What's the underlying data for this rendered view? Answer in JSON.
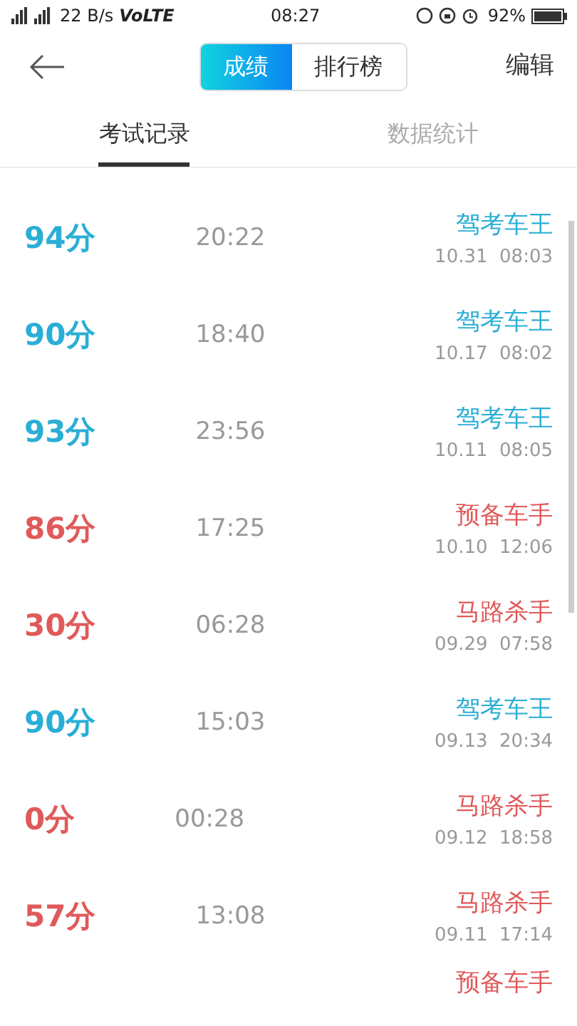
{
  "status_bar": {
    "network_speed": "22 B/s",
    "volte": "VoLTE",
    "time": "08:27",
    "battery": "92%"
  },
  "header": {
    "segments": [
      {
        "label": "成绩",
        "selected": true
      },
      {
        "label": "排行榜",
        "selected": false
      }
    ],
    "action": "编辑"
  },
  "tabs": [
    {
      "label": "考试记录",
      "selected": true
    },
    {
      "label": "数据统计",
      "selected": false
    }
  ],
  "records": [
    {
      "score": "94分",
      "duration": "20:22",
      "title": "驾考车王",
      "date": "10.31  08:03",
      "color": "#2aaed6"
    },
    {
      "score": "90分",
      "duration": "18:40",
      "title": "驾考车王",
      "date": "10.17  08:02",
      "color": "#2aaed6"
    },
    {
      "score": "93分",
      "duration": "23:56",
      "title": "驾考车王",
      "date": "10.11  08:05",
      "color": "#2aaed6"
    },
    {
      "score": "86分",
      "duration": "17:25",
      "title": "预备车手",
      "date": "10.10  12:06",
      "color": "#e05a5a"
    },
    {
      "score": "30分",
      "duration": "06:28",
      "title": "马路杀手",
      "date": "09.29  07:58",
      "color": "#e05a5a"
    },
    {
      "score": "90分",
      "duration": "15:03",
      "title": "驾考车王",
      "date": "09.13  20:34",
      "color": "#2aaed6"
    },
    {
      "score": "0分",
      "duration": "00:28",
      "title": "马路杀手",
      "date": "09.12  18:58",
      "color": "#e05a5a"
    },
    {
      "score": "57分",
      "duration": "13:08",
      "title": "马路杀手",
      "date": "09.11  17:14",
      "color": "#e05a5a"
    },
    {
      "title": "预备车手",
      "color": "#e05a5a"
    }
  ]
}
